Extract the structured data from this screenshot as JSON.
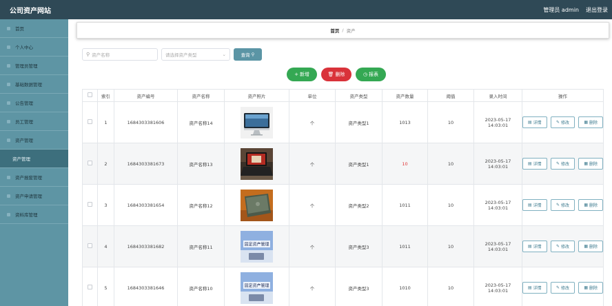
{
  "header": {
    "title": "公司资产网站",
    "user_label": "管理员 admin",
    "logout": "退出登录"
  },
  "sidebar": {
    "items": [
      {
        "label": "首页"
      },
      {
        "label": "个人中心"
      },
      {
        "label": "管理员管理"
      },
      {
        "label": "基础数据管理"
      },
      {
        "label": "公告管理"
      },
      {
        "label": "员工管理"
      },
      {
        "label": "资产管理"
      },
      {
        "label": "资产管理"
      },
      {
        "label": "资产报废管理"
      },
      {
        "label": "资产申请管理"
      },
      {
        "label": "资料库管理"
      }
    ]
  },
  "breadcrumb": {
    "home": "首页",
    "separator": "/",
    "current": "资产"
  },
  "search": {
    "name_placeholder": "资产名称",
    "type_placeholder": "请选择资产类型",
    "query_label": "查询"
  },
  "actions": {
    "add": "新增",
    "delete": "删除",
    "report": "报表"
  },
  "table": {
    "headers": [
      "索引",
      "资产编号",
      "资产名称",
      "资产照片",
      "单位",
      "资产类型",
      "资产数量",
      "阈值",
      "录入时间",
      "操作"
    ],
    "op_labels": {
      "detail": "详情",
      "edit": "修改",
      "delete": "删除"
    },
    "rows": [
      {
        "index": "1",
        "code": "1684303381606",
        "name": "资产名称14",
        "unit": "个",
        "type": "资产类型1",
        "qty": "1013",
        "threshold": "10",
        "time": "2023-05-17 14:03:01",
        "photo": "imac"
      },
      {
        "index": "2",
        "code": "1684303381673",
        "name": "资产名称13",
        "unit": "个",
        "type": "资产类型1",
        "qty": "10",
        "threshold": "10",
        "time": "2023-05-17 14:03:01",
        "photo": "laptop"
      },
      {
        "index": "3",
        "code": "1684303381654",
        "name": "资产名称12",
        "unit": "个",
        "type": "资产类型2",
        "qty": "1011",
        "threshold": "10",
        "time": "2023-05-17 14:03:01",
        "photo": "laptop-closed"
      },
      {
        "index": "4",
        "code": "1684303381682",
        "name": "资产名称11",
        "unit": "个",
        "type": "资产类型3",
        "qty": "1011",
        "threshold": "10",
        "time": "2023-05-17 14:03:01",
        "photo": "asset-poster",
        "photo_text": "固定资产管理"
      },
      {
        "index": "5",
        "code": "1684303381646",
        "name": "资产名称10",
        "unit": "个",
        "type": "资产类型3",
        "qty": "1010",
        "threshold": "10",
        "time": "2023-05-17 14:03:01",
        "photo": "asset-poster",
        "photo_text": "固定资产管理"
      }
    ]
  },
  "colors": {
    "topbar": "#2f4956",
    "sidebar": "#5e95a4",
    "sidebar_active": "#3d6f7d",
    "primary": "#5b95a5",
    "success": "#34a853",
    "danger": "#d9323a",
    "warn_qty": "#e03434"
  }
}
